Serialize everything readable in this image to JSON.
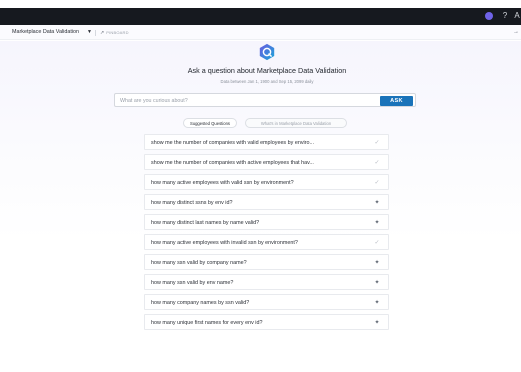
{
  "topbar": {
    "icons": [
      {
        "name": "avatar",
        "color": "#6f63e8"
      },
      {
        "name": "help-icon",
        "glyph": "?"
      },
      {
        "name": "user-icon",
        "glyph": "A"
      }
    ]
  },
  "subbar": {
    "dataset_title": "Marketplace Data Validation",
    "pin_glyph": "↗",
    "pin_label": "PINBOARD",
    "collapse_glyph": "→"
  },
  "hero": {
    "title": "Ask a question about Marketplace Data Validation",
    "subtitle": "Data between Jan 1, 1900 and Sep 15, 2099 daily"
  },
  "search": {
    "placeholder": "What are you curious about?",
    "value": "",
    "ask_label": "ASK",
    "ask_color": "#1a73b9"
  },
  "tabs": [
    {
      "label": "Suggested Questions",
      "active": true
    },
    {
      "label": "What's in Marketplace Data Validation",
      "active": false
    }
  ],
  "questions": [
    {
      "text": "show me the number of companies with valid employees by enviro...",
      "icon": "check-icon"
    },
    {
      "text": "show me the number of companies with active employees that hav...",
      "icon": "check-icon"
    },
    {
      "text": "how many active employees with valid ssn by environment?",
      "icon": "check-icon"
    },
    {
      "text": "how many distinct ssns by env id?",
      "icon": "sparkle-icon"
    },
    {
      "text": "how many distinct last names by name valid?",
      "icon": "sparkle-icon"
    },
    {
      "text": "how many active employees with invalid ssn by environment?",
      "icon": "check-icon"
    },
    {
      "text": "how many ssn valid by company name?",
      "icon": "sparkle-icon"
    },
    {
      "text": "how many ssn valid by env name?",
      "icon": "sparkle-icon"
    },
    {
      "text": "how many company names by ssn valid?",
      "icon": "sparkle-icon"
    },
    {
      "text": "how many unique first names for every env id?",
      "icon": "sparkle-icon"
    }
  ]
}
